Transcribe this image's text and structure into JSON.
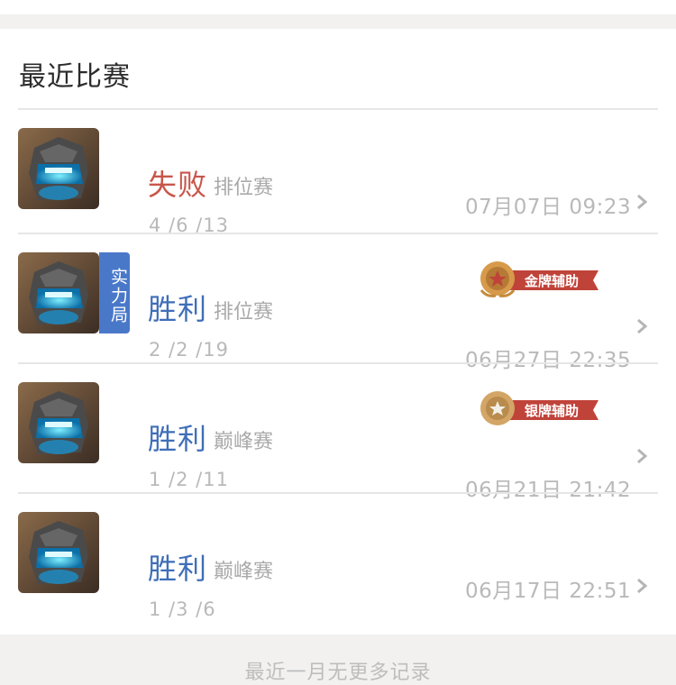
{
  "section": {
    "title": "最近比赛"
  },
  "matches": [
    {
      "result": "失败",
      "mode": "排位赛",
      "kda": "4 /6 /13",
      "time": "07月07日 09:23",
      "badge": "",
      "strength_tag": ""
    },
    {
      "result": "胜利",
      "mode": "排位赛",
      "kda": "2 /2 /19",
      "time": "06月27日 22:35",
      "badge": "金牌辅助",
      "strength_tag": "实力局"
    },
    {
      "result": "胜利",
      "mode": "巅峰赛",
      "kda": "1 /2 /11",
      "time": "06月21日 21:42",
      "badge": "银牌辅助",
      "strength_tag": ""
    },
    {
      "result": "胜利",
      "mode": "巅峰赛",
      "kda": "1 /3 /6",
      "time": "06月17日 22:51",
      "badge": "",
      "strength_tag": ""
    }
  ],
  "footer": {
    "text": "最近一月无更多记录"
  },
  "colors": {
    "lose": "#c8564a",
    "win": "#3f6eb8",
    "strength_tag": "#4a78c9",
    "gold_badge": "#c0433a",
    "silver_badge": "#c0433a"
  }
}
